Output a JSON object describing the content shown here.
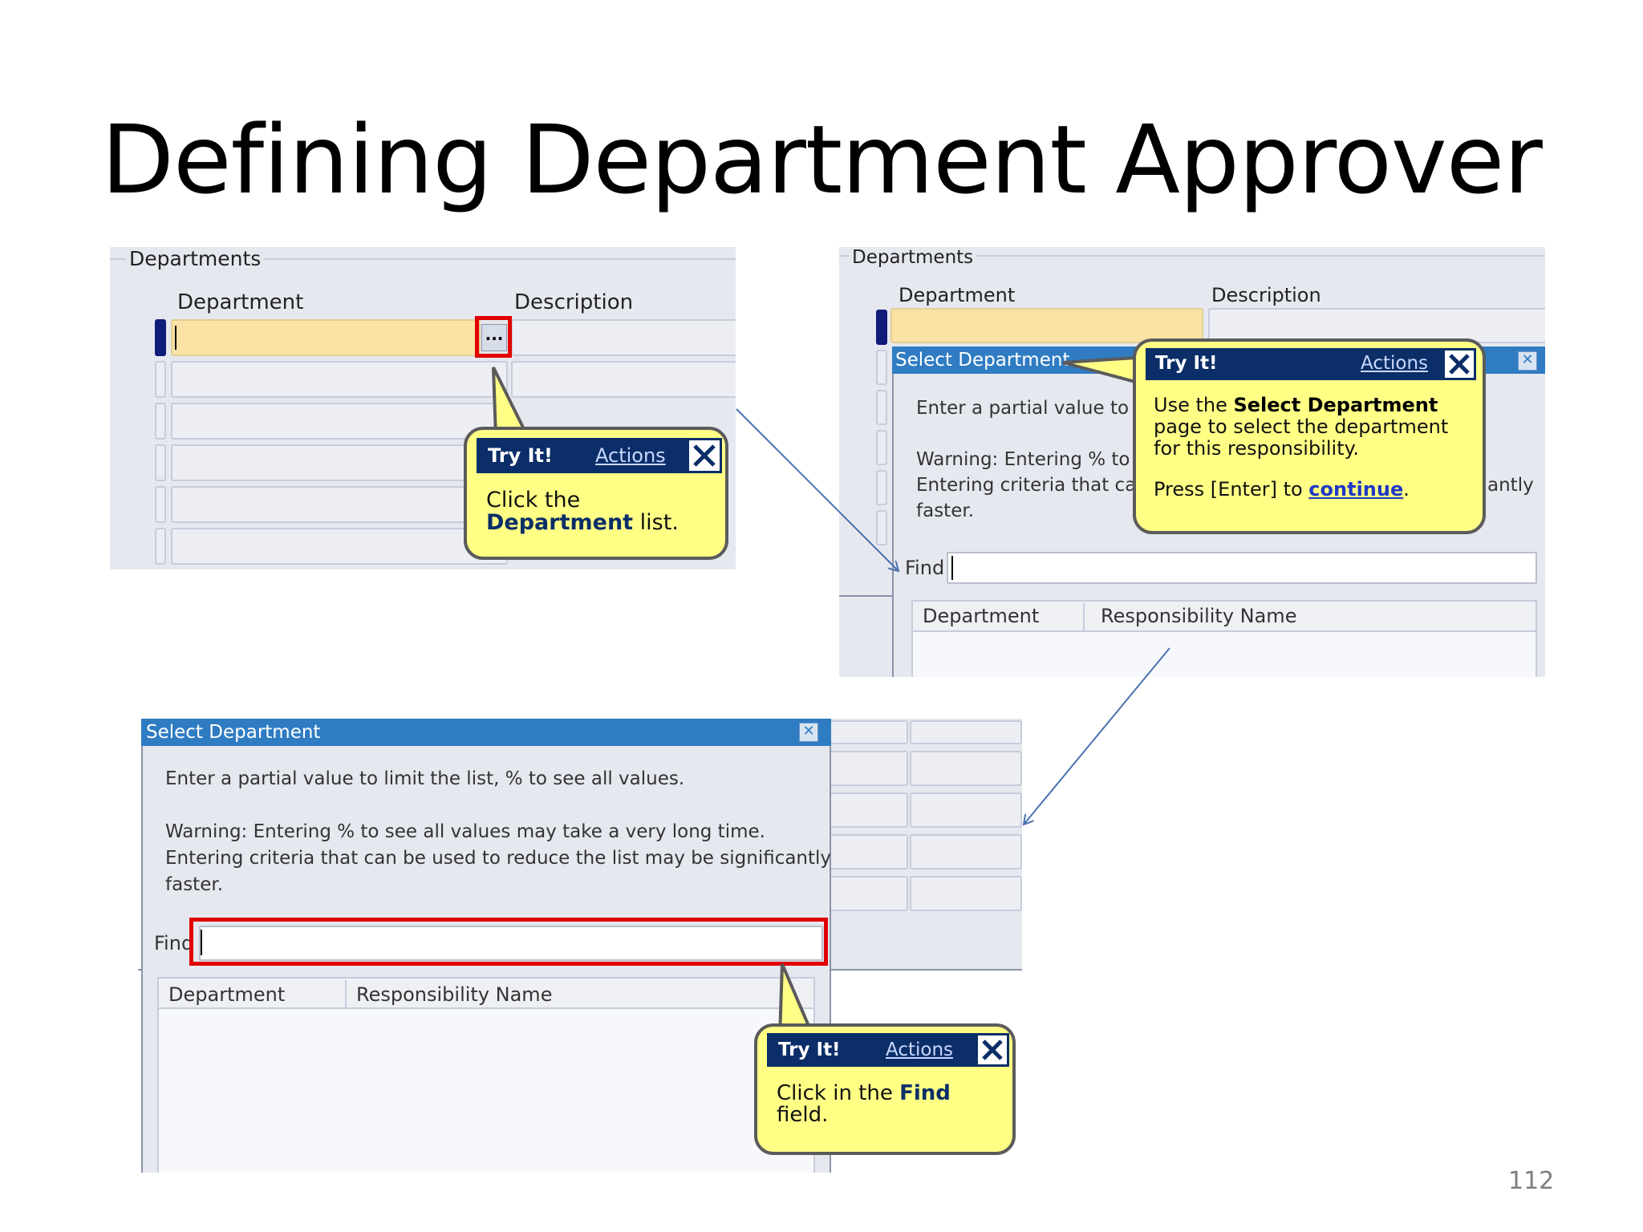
{
  "slide": {
    "title": "Defining Department Approver",
    "page_number": "112"
  },
  "panel1": {
    "group_label": "Departments",
    "col_department": "Department",
    "col_description": "Description",
    "lov_button": "...",
    "tip": {
      "head": "Try It!",
      "actions": "Actions",
      "line1": "Click the",
      "line2_bold": "Department",
      "line2_rest": " list."
    }
  },
  "panel2": {
    "group_label": "Departments",
    "col_department": "Department",
    "col_description": "Description",
    "dialog_title": "Select Department",
    "text1": "Enter a partial value to lir",
    "warn1": "Warning: Entering % to s",
    "warn2": "Entering criteria that can",
    "warn3": "faster.",
    "warn_tail": "antly",
    "find_label": "Find",
    "col1": "Department",
    "col2": "Responsibility Name",
    "tip": {
      "head": "Try It!",
      "actions": "Actions",
      "p1a": "Use the ",
      "p1b": "Select Department",
      "p2": "page to select the department",
      "p3": "for this responsibility.",
      "p4a": "Press [Enter] to ",
      "p4b": "continue",
      "p4c": "."
    }
  },
  "panel3": {
    "dialog_title": "Select Department",
    "text1": "Enter a partial value to limit the list, % to see all values.",
    "warn1": "Warning: Entering % to see all values may take a very long time.",
    "warn2": "Entering criteria that can be used to reduce the list may be significantly",
    "warn3": "faster.",
    "find_label": "Find",
    "col1": "Department",
    "col2": "Responsibility Name",
    "tip": {
      "head": "Try It!",
      "actions": "Actions",
      "l1a": "Click in the ",
      "l1b": "Find",
      "l2": "field."
    }
  }
}
